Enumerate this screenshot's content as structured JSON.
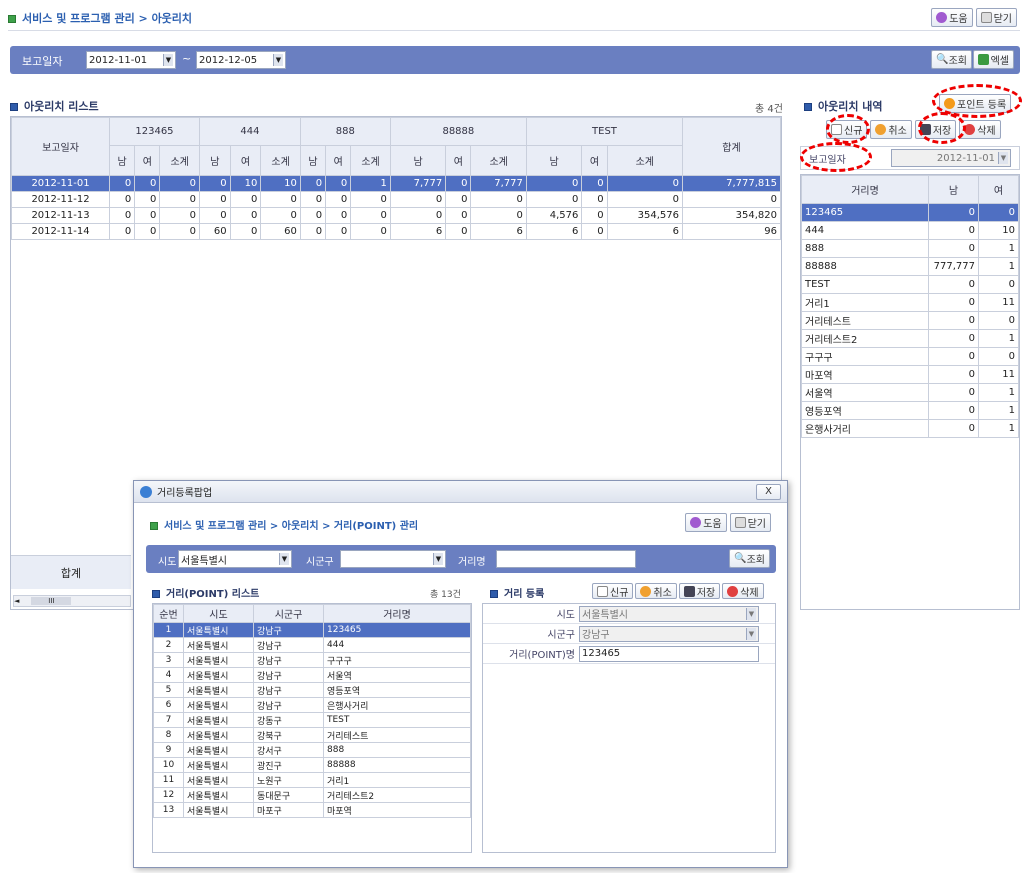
{
  "header": {
    "breadcrumb": "서비스 및 프로그램 관리 > 아웃리치",
    "help": "도움",
    "close": "닫기"
  },
  "search": {
    "label": "보고일자",
    "from": "2012-11-01",
    "to": "2012-12-05",
    "sep": "~",
    "query": "조회",
    "excel": "엑셀"
  },
  "list": {
    "title": "아웃리치 리스트",
    "count": "총 4건",
    "date_header": "보고일자",
    "total_header": "합계",
    "groups": [
      "123465",
      "444",
      "888",
      "88888",
      "TEST"
    ],
    "sub": [
      "남",
      "여",
      "소계"
    ],
    "rows": [
      {
        "date": "2012-11-01",
        "v": [
          "0",
          "0",
          "0",
          "0",
          "10",
          "10",
          "0",
          "0",
          "1",
          "7,777",
          "0",
          "7,777",
          "0",
          "0",
          "0"
        ],
        "total": "7,777,815",
        "sel": true
      },
      {
        "date": "2012-11-12",
        "v": [
          "0",
          "0",
          "0",
          "0",
          "0",
          "0",
          "0",
          "0",
          "0",
          "0",
          "0",
          "0",
          "0",
          "0",
          "0"
        ],
        "total": "0",
        "sel": false
      },
      {
        "date": "2012-11-13",
        "v": [
          "0",
          "0",
          "0",
          "0",
          "0",
          "0",
          "0",
          "0",
          "0",
          "0",
          "0",
          "0",
          "4,576",
          "0",
          "354,576"
        ],
        "total": "354,820",
        "sel": false
      },
      {
        "date": "2012-11-14",
        "v": [
          "0",
          "0",
          "0",
          "60",
          "0",
          "60",
          "0",
          "0",
          "0",
          "6",
          "0",
          "6",
          "6",
          "0",
          "6"
        ],
        "total": "96",
        "sel": false
      }
    ],
    "sum_label": "합계",
    "scroll": "III"
  },
  "detail": {
    "title": "아웃리치 내역",
    "point_reg": "포인트 등록",
    "new": "신규",
    "cancel": "취소",
    "save": "저장",
    "delete": "삭제",
    "date_label": "보고일자",
    "date": "2012-11-01",
    "headers": [
      "거리명",
      "남",
      "여"
    ],
    "rows": [
      [
        "123465",
        "0",
        "0"
      ],
      [
        "444",
        "0",
        "10"
      ],
      [
        "888",
        "0",
        "1"
      ],
      [
        "88888",
        "777,777",
        "1"
      ],
      [
        "TEST",
        "0",
        "0"
      ],
      [
        "거리1",
        "0",
        "11"
      ],
      [
        "거리테스트",
        "0",
        "0"
      ],
      [
        "거리테스트2",
        "0",
        "1"
      ],
      [
        "구구구",
        "0",
        "0"
      ],
      [
        "마포역",
        "0",
        "11"
      ],
      [
        "서울역",
        "0",
        "1"
      ],
      [
        "영등포역",
        "0",
        "1"
      ],
      [
        "은행사거리",
        "0",
        "1"
      ]
    ]
  },
  "popup": {
    "window_title": "거리등록팝업",
    "close_x": "X",
    "breadcrumb": "서비스 및 프로그램 관리 > 아웃리치 > 거리(POINT) 관리",
    "help": "도움",
    "close": "닫기",
    "search": {
      "sido_label": "시도",
      "sido": "서울특별시",
      "sigungu_label": "시군구",
      "sigungu": "",
      "street_label": "거리명",
      "street": "",
      "query": "조회"
    },
    "list": {
      "title": "거리(POINT) 리스트",
      "count": "총 13건",
      "headers": [
        "순번",
        "시도",
        "시군구",
        "거리명"
      ],
      "rows": [
        [
          "1",
          "서울특별시",
          "강남구",
          "123465"
        ],
        [
          "2",
          "서울특별시",
          "강남구",
          "444"
        ],
        [
          "3",
          "서울특별시",
          "강남구",
          "구구구"
        ],
        [
          "4",
          "서울특별시",
          "강남구",
          "서울역"
        ],
        [
          "5",
          "서울특별시",
          "강남구",
          "영등포역"
        ],
        [
          "6",
          "서울특별시",
          "강남구",
          "은행사거리"
        ],
        [
          "7",
          "서울특별시",
          "강동구",
          "TEST"
        ],
        [
          "8",
          "서울특별시",
          "강북구",
          "거리테스트"
        ],
        [
          "9",
          "서울특별시",
          "강서구",
          "888"
        ],
        [
          "10",
          "서울특별시",
          "광진구",
          "88888"
        ],
        [
          "11",
          "서울특별시",
          "노원구",
          "거리1"
        ],
        [
          "12",
          "서울특별시",
          "동대문구",
          "거리테스트2"
        ],
        [
          "13",
          "서울특별시",
          "마포구",
          "마포역"
        ]
      ]
    },
    "form": {
      "title": "거리 등록",
      "new": "신규",
      "cancel": "취소",
      "save": "저장",
      "delete": "삭제",
      "sido_label": "시도",
      "sido": "서울특별시",
      "sigungu_label": "시군구",
      "sigungu": "강남구",
      "name_label": "거리(POINT)명",
      "name": "123465"
    }
  }
}
